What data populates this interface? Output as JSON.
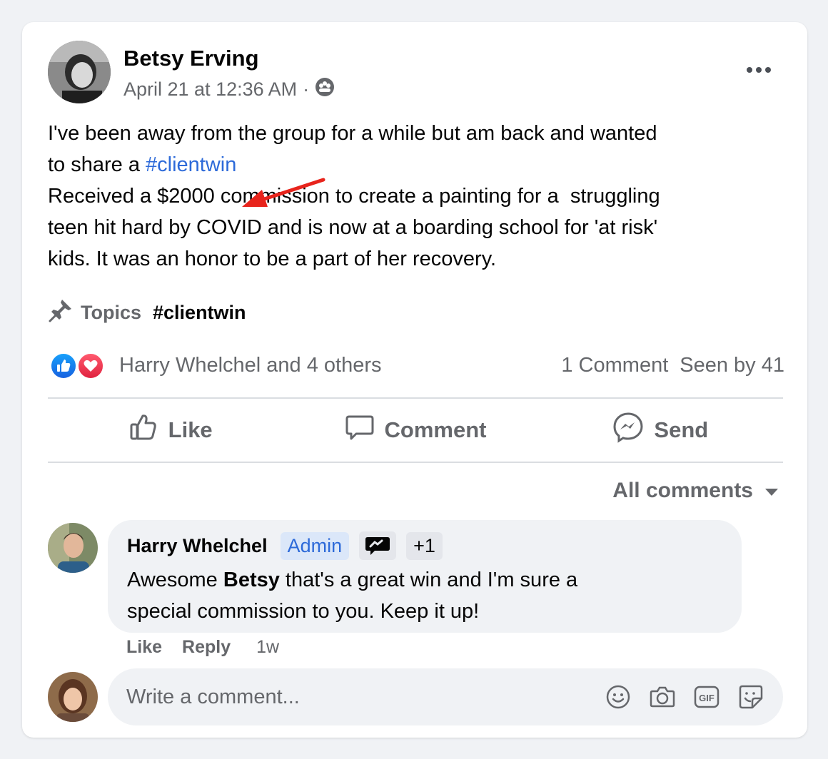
{
  "post": {
    "author": "Betsy Erving",
    "timestamp": "April 21 at 12:36 AM",
    "separator": "·",
    "audience_icon": "group-icon",
    "text_lines": [
      [
        "I've been away from the group for a while but am back and wanted",
        ""
      ],
      [
        "to share a ",
        "#clientwin"
      ],
      [
        "Received a $2000 commission to create a painting for a  struggling",
        ""
      ],
      [
        "teen hit hard by COVID and is now at a boarding school for 'at risk'",
        ""
      ],
      [
        "kids. It was an honor to be a part of her recovery.",
        ""
      ]
    ],
    "topics_label": "Topics",
    "topic_tag": "#clientwin",
    "reactions_summary": "Harry Whelchel and 4 others",
    "comment_count": "1 Comment",
    "seen_by": "Seen by 41",
    "colors": {
      "accent": "#2d6ad9",
      "annotation_arrow": "#e8241c"
    }
  },
  "actions": {
    "like": "Like",
    "comment": "Comment",
    "send": "Send"
  },
  "comments_filter": "All comments",
  "comment": {
    "author": "Harry Whelchel",
    "badge_admin": "Admin",
    "badge_extra": "+1",
    "body_prefix": "Awesome ",
    "body_bold": "Betsy",
    "body_suffix_line1": " that's a great win and I'm sure a",
    "body_line2": "special commission to you. Keep it up!",
    "like": "Like",
    "reply": "Reply",
    "time": "1w"
  },
  "composer": {
    "placeholder": "Write a comment..."
  }
}
